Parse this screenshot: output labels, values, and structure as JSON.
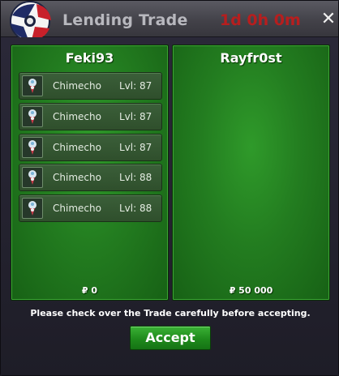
{
  "window": {
    "title": "Lending Trade",
    "timer": "1d 0h 0m",
    "close_glyph": "✕"
  },
  "left_panel": {
    "player": "Feki93",
    "money": "₽ 0",
    "items": [
      {
        "pokemon": "Chimecho",
        "level": "Lvl: 87",
        "icon": "chimecho-icon"
      },
      {
        "pokemon": "Chimecho",
        "level": "Lvl: 87",
        "icon": "chimecho-icon"
      },
      {
        "pokemon": "Chimecho",
        "level": "Lvl: 87",
        "icon": "chimecho-icon"
      },
      {
        "pokemon": "Chimecho",
        "level": "Lvl: 88",
        "icon": "chimecho-icon"
      },
      {
        "pokemon": "Chimecho",
        "level": "Lvl: 88",
        "icon": "chimecho-icon"
      }
    ]
  },
  "right_panel": {
    "player": "Rayfr0st",
    "money": "₽ 50 000",
    "items": []
  },
  "footer": {
    "note": "Please check over the Trade carefully before accepting.",
    "accept_label": "Accept"
  },
  "colors": {
    "timer": "#b71e1e",
    "panel_green": "#237d20",
    "accept_green": "#1f8a1c"
  }
}
